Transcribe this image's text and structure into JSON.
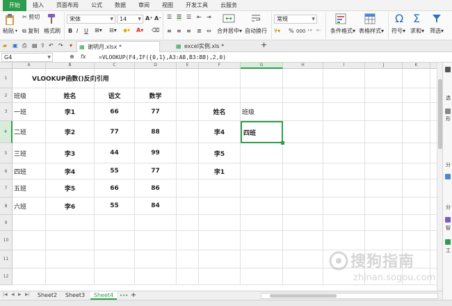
{
  "menu": [
    "开始",
    "插入",
    "页面布局",
    "公式",
    "数据",
    "审阅",
    "视图",
    "开发工具",
    "云服务"
  ],
  "ribbon": {
    "paste": "粘贴",
    "cut": "剪切",
    "copy": "复制",
    "format_painter": "格式刷",
    "font_name": "宋体",
    "font_size": "14",
    "number_format": "常规",
    "merge_center": "合并居中",
    "wrap_text": "自动换行",
    "percent": "%",
    "comma": "000",
    "cond_format": "条件格式",
    "table_style": "表格样式",
    "symbol": "符号",
    "sum": "求和",
    "filter": "筛选"
  },
  "doc_tabs": {
    "tab1": "谢明月.xlsx *",
    "tab2": "excel实例.xls *",
    "add": "+"
  },
  "formula_bar": {
    "name_box": "G4",
    "fx": "fx",
    "formula": "=VLOOKUP(F4,IF({0,1},A3:A8,B3:B8),2,0)"
  },
  "columns": [
    "A",
    "B",
    "C",
    "D",
    "E",
    "F",
    "G",
    "H",
    "I",
    "J",
    "K",
    "L"
  ],
  "rows": [
    "1",
    "2",
    "3",
    "4",
    "5",
    "6",
    "7",
    "8",
    "9",
    "10",
    "11",
    "12"
  ],
  "cells": {
    "A1": "VLOOKUP函数()反向引用",
    "A2": "班级",
    "B2": "姓名",
    "C2": "语文",
    "D2": "数学",
    "A3": "一班",
    "B3": "李1",
    "C3": "66",
    "D3": "77",
    "F3": "姓名",
    "G3": "班级",
    "A4": "二班",
    "B4": "李2",
    "C4": "77",
    "D4": "88",
    "F4": "李4",
    "G4": "四班",
    "A5": "三班",
    "B5": "李3",
    "C5": "44",
    "D5": "99",
    "F5": "李5",
    "A6": "四班",
    "B6": "李4",
    "C6": "55",
    "D6": "77",
    "F6": "李1",
    "A7": "五班",
    "B7": "李5",
    "C7": "66",
    "D7": "86",
    "A8": "六班",
    "B8": "李6",
    "C8": "55",
    "D8": "84"
  },
  "sheets": [
    "Sheet2",
    "Sheet3",
    "Sheet4"
  ],
  "active_sheet": "Sheet4",
  "sheet_more": "•••",
  "sheet_add": "+",
  "side_pane": [
    "选",
    "形",
    "分",
    "分",
    "智",
    "工"
  ],
  "watermark": {
    "main": "搜狗指南",
    "url": "zhinan.sogou.com"
  },
  "colors": {
    "accent": "#2e9c4a",
    "header_bg": "#ececec"
  }
}
